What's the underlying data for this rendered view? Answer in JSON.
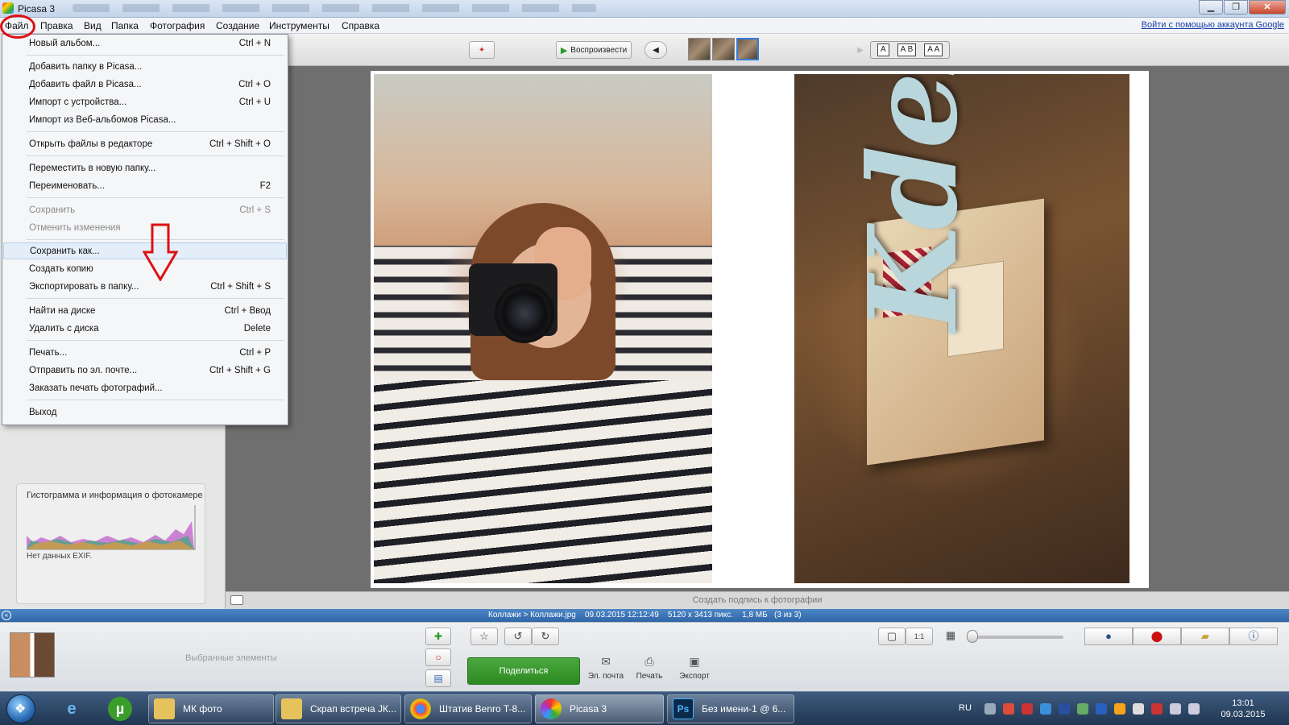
{
  "window": {
    "title": "Picasa 3",
    "controls": [
      "minimize",
      "maximize",
      "close"
    ]
  },
  "menubar": {
    "items": [
      "Файл",
      "Правка",
      "Вид",
      "Папка",
      "Фотография",
      "Создание",
      "Инструменты",
      "Справка"
    ],
    "google_link": "Войти с помощью аккаунта Google"
  },
  "toolbar": {
    "play_label": "Воспроизвести",
    "caption_buttons": [
      "A",
      "A B",
      "A A"
    ]
  },
  "file_menu": {
    "items": [
      {
        "label": "Новый альбом...",
        "shortcut": "Ctrl + N",
        "disabled": false
      },
      {
        "label": "Добавить папку в Picasa...",
        "shortcut": "",
        "disabled": false
      },
      {
        "label": "Добавить файл в Picasa...",
        "shortcut": "Ctrl + O",
        "disabled": false
      },
      {
        "label": "Импорт с устройства...",
        "shortcut": "Ctrl + U",
        "disabled": false
      },
      {
        "label": "Импорт из Веб-альбомов Picasa...",
        "shortcut": "",
        "disabled": false
      },
      {
        "label": "Открыть файлы в редакторе",
        "shortcut": "Ctrl + Shift + O",
        "disabled": false
      },
      {
        "label": "Переместить в новую папку...",
        "shortcut": "",
        "disabled": false
      },
      {
        "label": "Переименовать...",
        "shortcut": "F2",
        "disabled": false
      },
      {
        "label": "Сохранить",
        "shortcut": "Ctrl + S",
        "disabled": true
      },
      {
        "label": "Отменить изменения",
        "shortcut": "",
        "disabled": true
      },
      {
        "label": "Сохранить как...",
        "shortcut": "",
        "disabled": false,
        "highlighted": true
      },
      {
        "label": "Создать копию",
        "shortcut": "",
        "disabled": false
      },
      {
        "label": "Экспортировать в папку...",
        "shortcut": "Ctrl + Shift + S",
        "disabled": false
      },
      {
        "label": "Найти на диске",
        "shortcut": "Ctrl + Ввод",
        "disabled": false
      },
      {
        "label": "Удалить с диска",
        "shortcut": "Delete",
        "disabled": false
      },
      {
        "label": "Печать...",
        "shortcut": "Ctrl + P",
        "disabled": false
      },
      {
        "label": "Отправить по эл. почте...",
        "shortcut": "Ctrl + Shift + G",
        "disabled": false
      },
      {
        "label": "Заказать печать фотографий...",
        "shortcut": "",
        "disabled": false
      },
      {
        "label": "Выход",
        "shortcut": "",
        "disabled": false
      }
    ]
  },
  "histogram": {
    "title": "Гистограмма и информация о фотокамере",
    "exif": "Нет данных EXIF."
  },
  "photos": {
    "photo2_text": "Kdesign"
  },
  "caption_bar": {
    "placeholder": "Создать подпись к фотографии"
  },
  "infobar": {
    "path": "Коллажи > Коллажи.jpg",
    "datetime": "09.03.2015 12:12:49",
    "dimensions": "5120 x 3413 пикс.",
    "size": "1,8 МБ",
    "position": "(3 из 3)"
  },
  "tray": {
    "held_label": "Выбранные элементы",
    "share_label": "Поделиться",
    "actions": [
      "Эл. почта",
      "Печать",
      "Экспорт"
    ]
  },
  "taskbar": {
    "tasks": [
      "МК фото",
      "Скрап встреча ЈК...",
      "Штатив Benro T-8...",
      "Picasa 3",
      "Без имени-1 @ 6..."
    ],
    "lang": "RU",
    "time": "13:01",
    "date": "09.03.2015"
  },
  "colors": {
    "accent_red": "#dd1111",
    "share_green": "#2c8a22",
    "infobar_blue": "#2e66a8"
  }
}
